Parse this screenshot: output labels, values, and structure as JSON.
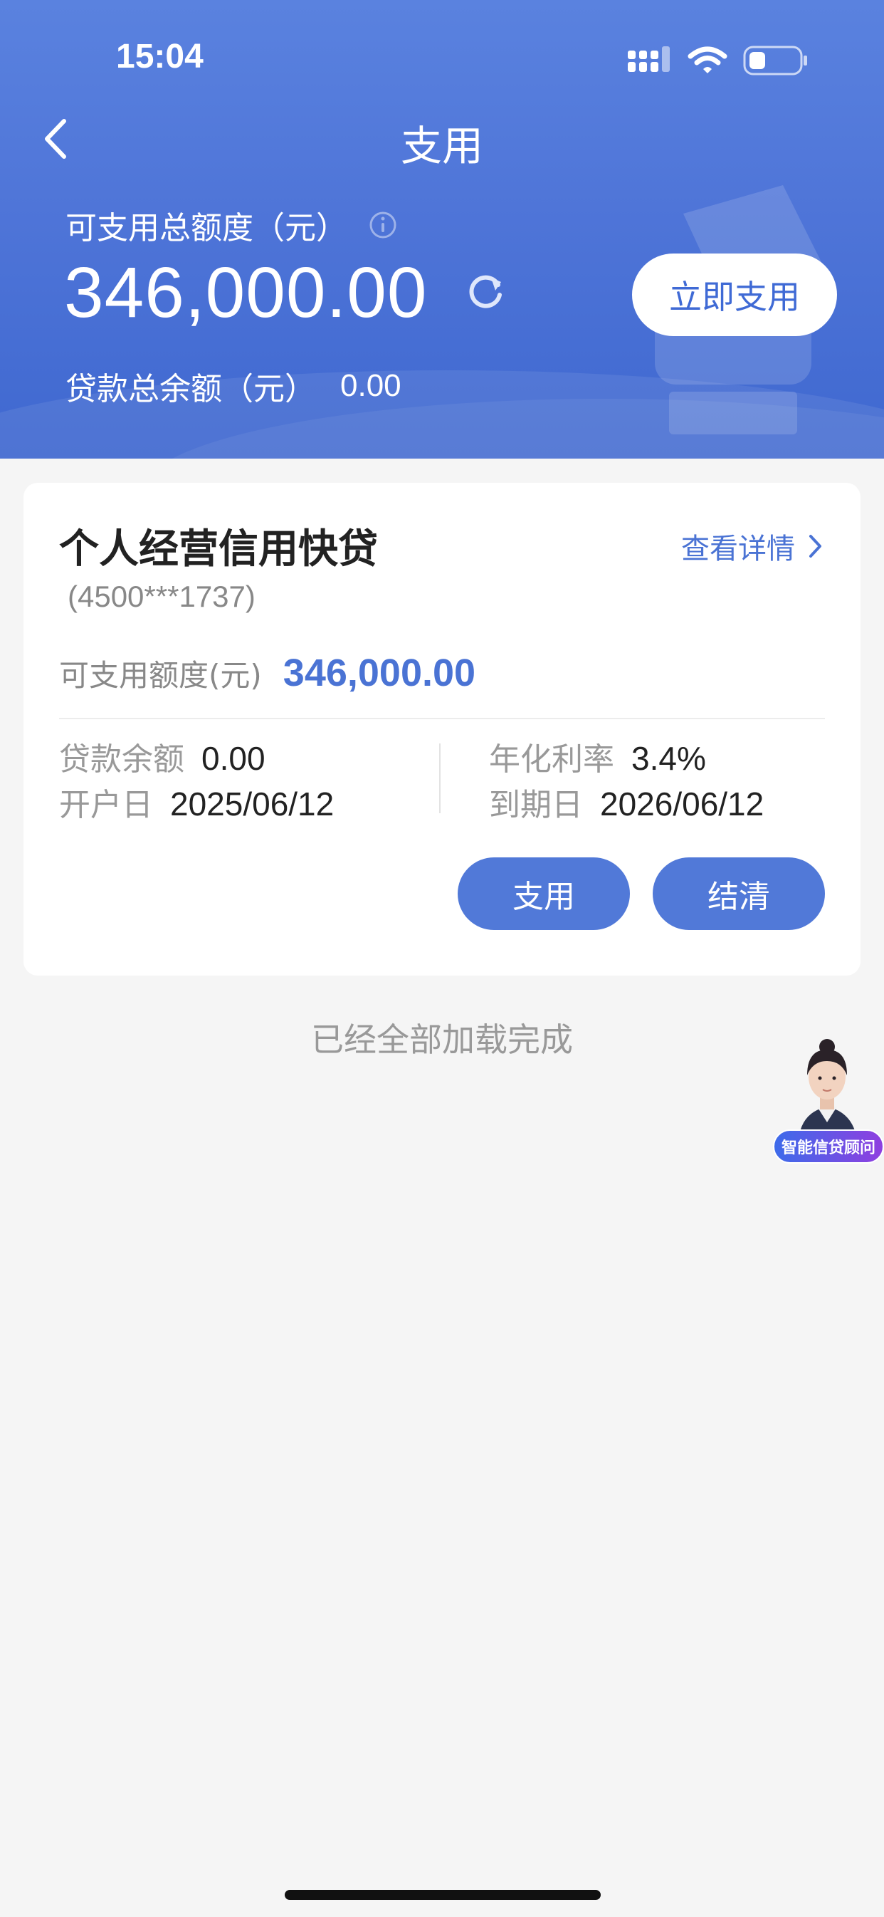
{
  "status_bar": {
    "time": "15:04"
  },
  "header": {
    "title": "支用",
    "total_label": "可支用总额度（元）",
    "total_amount": "346,000.00",
    "use_now_label": "立即支用",
    "balance_label": "贷款总余额（元）",
    "balance_value": "0.00"
  },
  "card": {
    "product_name": "个人经营信用快贷",
    "account": "(4500***1737)",
    "detail_link": "查看详情",
    "available_label": "可支用额度(元)",
    "available_value": "346,000.00",
    "loan_balance_label": "贷款余额",
    "loan_balance_value": "0.00",
    "rate_label": "年化利率",
    "rate_value": "3.4%",
    "open_date_label": "开户日",
    "open_date_value": "2025/06/12",
    "due_date_label": "到期日",
    "due_date_value": "2026/06/12",
    "withdraw_button": "支用",
    "settle_button": "结清"
  },
  "footer_text": "已经全部加载完成",
  "assistant": {
    "label": "智能信贷顾问"
  },
  "colors": {
    "primary": "#4f75d8",
    "accent_text": "#4a73d4"
  }
}
